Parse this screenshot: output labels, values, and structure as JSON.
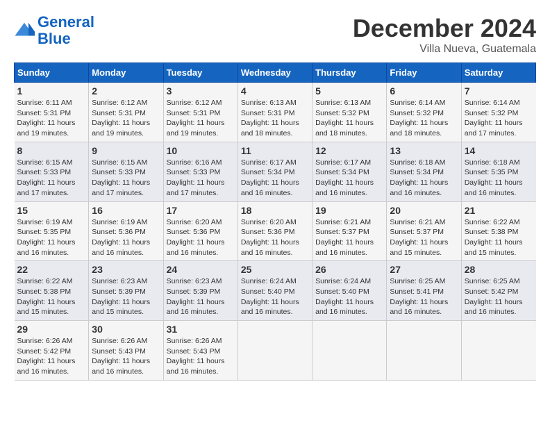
{
  "header": {
    "logo_line1": "General",
    "logo_line2": "Blue",
    "month_year": "December 2024",
    "location": "Villa Nueva, Guatemala"
  },
  "days_of_week": [
    "Sunday",
    "Monday",
    "Tuesday",
    "Wednesday",
    "Thursday",
    "Friday",
    "Saturday"
  ],
  "weeks": [
    [
      {
        "day": "1",
        "text": "Sunrise: 6:11 AM\nSunset: 5:31 PM\nDaylight: 11 hours\nand 19 minutes."
      },
      {
        "day": "2",
        "text": "Sunrise: 6:12 AM\nSunset: 5:31 PM\nDaylight: 11 hours\nand 19 minutes."
      },
      {
        "day": "3",
        "text": "Sunrise: 6:12 AM\nSunset: 5:31 PM\nDaylight: 11 hours\nand 19 minutes."
      },
      {
        "day": "4",
        "text": "Sunrise: 6:13 AM\nSunset: 5:31 PM\nDaylight: 11 hours\nand 18 minutes."
      },
      {
        "day": "5",
        "text": "Sunrise: 6:13 AM\nSunset: 5:32 PM\nDaylight: 11 hours\nand 18 minutes."
      },
      {
        "day": "6",
        "text": "Sunrise: 6:14 AM\nSunset: 5:32 PM\nDaylight: 11 hours\nand 18 minutes."
      },
      {
        "day": "7",
        "text": "Sunrise: 6:14 AM\nSunset: 5:32 PM\nDaylight: 11 hours\nand 17 minutes."
      }
    ],
    [
      {
        "day": "8",
        "text": "Sunrise: 6:15 AM\nSunset: 5:33 PM\nDaylight: 11 hours\nand 17 minutes."
      },
      {
        "day": "9",
        "text": "Sunrise: 6:15 AM\nSunset: 5:33 PM\nDaylight: 11 hours\nand 17 minutes."
      },
      {
        "day": "10",
        "text": "Sunrise: 6:16 AM\nSunset: 5:33 PM\nDaylight: 11 hours\nand 17 minutes."
      },
      {
        "day": "11",
        "text": "Sunrise: 6:17 AM\nSunset: 5:34 PM\nDaylight: 11 hours\nand 16 minutes."
      },
      {
        "day": "12",
        "text": "Sunrise: 6:17 AM\nSunset: 5:34 PM\nDaylight: 11 hours\nand 16 minutes."
      },
      {
        "day": "13",
        "text": "Sunrise: 6:18 AM\nSunset: 5:34 PM\nDaylight: 11 hours\nand 16 minutes."
      },
      {
        "day": "14",
        "text": "Sunrise: 6:18 AM\nSunset: 5:35 PM\nDaylight: 11 hours\nand 16 minutes."
      }
    ],
    [
      {
        "day": "15",
        "text": "Sunrise: 6:19 AM\nSunset: 5:35 PM\nDaylight: 11 hours\nand 16 minutes."
      },
      {
        "day": "16",
        "text": "Sunrise: 6:19 AM\nSunset: 5:36 PM\nDaylight: 11 hours\nand 16 minutes."
      },
      {
        "day": "17",
        "text": "Sunrise: 6:20 AM\nSunset: 5:36 PM\nDaylight: 11 hours\nand 16 minutes."
      },
      {
        "day": "18",
        "text": "Sunrise: 6:20 AM\nSunset: 5:36 PM\nDaylight: 11 hours\nand 16 minutes."
      },
      {
        "day": "19",
        "text": "Sunrise: 6:21 AM\nSunset: 5:37 PM\nDaylight: 11 hours\nand 16 minutes."
      },
      {
        "day": "20",
        "text": "Sunrise: 6:21 AM\nSunset: 5:37 PM\nDaylight: 11 hours\nand 15 minutes."
      },
      {
        "day": "21",
        "text": "Sunrise: 6:22 AM\nSunset: 5:38 PM\nDaylight: 11 hours\nand 15 minutes."
      }
    ],
    [
      {
        "day": "22",
        "text": "Sunrise: 6:22 AM\nSunset: 5:38 PM\nDaylight: 11 hours\nand 15 minutes."
      },
      {
        "day": "23",
        "text": "Sunrise: 6:23 AM\nSunset: 5:39 PM\nDaylight: 11 hours\nand 15 minutes."
      },
      {
        "day": "24",
        "text": "Sunrise: 6:23 AM\nSunset: 5:39 PM\nDaylight: 11 hours\nand 16 minutes."
      },
      {
        "day": "25",
        "text": "Sunrise: 6:24 AM\nSunset: 5:40 PM\nDaylight: 11 hours\nand 16 minutes."
      },
      {
        "day": "26",
        "text": "Sunrise: 6:24 AM\nSunset: 5:40 PM\nDaylight: 11 hours\nand 16 minutes."
      },
      {
        "day": "27",
        "text": "Sunrise: 6:25 AM\nSunset: 5:41 PM\nDaylight: 11 hours\nand 16 minutes."
      },
      {
        "day": "28",
        "text": "Sunrise: 6:25 AM\nSunset: 5:42 PM\nDaylight: 11 hours\nand 16 minutes."
      }
    ],
    [
      {
        "day": "29",
        "text": "Sunrise: 6:26 AM\nSunset: 5:42 PM\nDaylight: 11 hours\nand 16 minutes."
      },
      {
        "day": "30",
        "text": "Sunrise: 6:26 AM\nSunset: 5:43 PM\nDaylight: 11 hours\nand 16 minutes."
      },
      {
        "day": "31",
        "text": "Sunrise: 6:26 AM\nSunset: 5:43 PM\nDaylight: 11 hours\nand 16 minutes."
      },
      {
        "day": "",
        "text": ""
      },
      {
        "day": "",
        "text": ""
      },
      {
        "day": "",
        "text": ""
      },
      {
        "day": "",
        "text": ""
      }
    ]
  ]
}
